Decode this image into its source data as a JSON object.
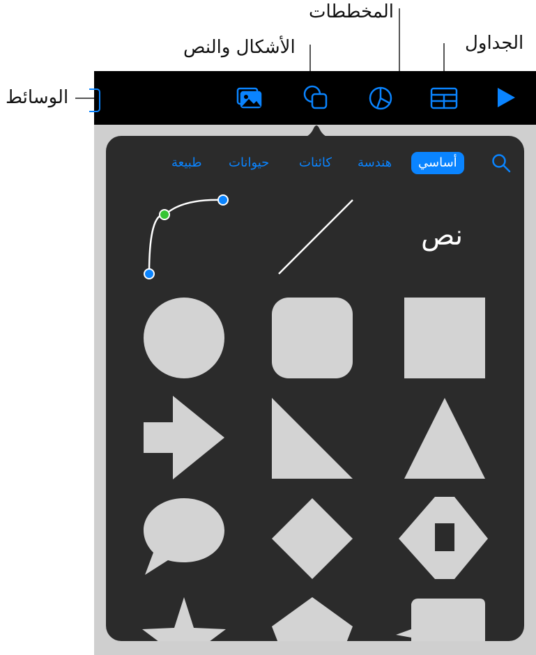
{
  "callouts": {
    "charts": "المخططات",
    "shapes_text": "الأشكال والنص",
    "tables": "الجداول",
    "media": "الوسائط"
  },
  "toolbar": {
    "buttons": [
      {
        "name": "media",
        "icon": "photo-icon"
      },
      {
        "name": "shapes",
        "icon": "shapes-icon"
      },
      {
        "name": "charts",
        "icon": "chart-icon"
      },
      {
        "name": "tables",
        "icon": "table-icon"
      },
      {
        "name": "play",
        "icon": "play-icon"
      }
    ],
    "accent": "#0a84ff"
  },
  "popover": {
    "search_icon": "search-icon",
    "tabs": [
      {
        "label": "أساسي",
        "active": true
      },
      {
        "label": "هندسة",
        "active": false
      },
      {
        "label": "كائنات",
        "active": false
      },
      {
        "label": "حيوانات",
        "active": false
      },
      {
        "label": "طبيعة",
        "active": false
      }
    ],
    "text_shape_label": "نص",
    "shape_color": "#d3d3d3",
    "background": "#2b2b2b"
  }
}
